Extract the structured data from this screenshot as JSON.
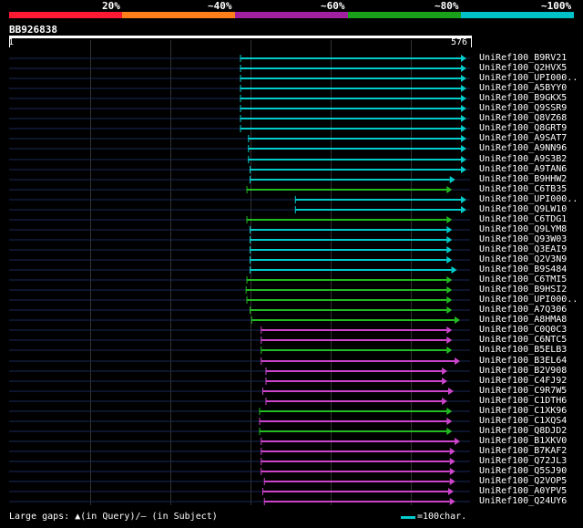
{
  "legend": {
    "labels": [
      "20%",
      "~40%",
      "~60%",
      "~80%",
      "~100%"
    ],
    "colors": [
      "#ff1a33",
      "#ff7f1a",
      "#a020a0",
      "#1aa01a",
      "#00c0c8"
    ]
  },
  "query": {
    "name": "BB926838",
    "start_label": "1",
    "end_label": "576",
    "length": 576
  },
  "hits": [
    {
      "label": "UniRef100_B9RV21",
      "start": 292,
      "end": 576,
      "color": "#00cccc"
    },
    {
      "label": "UniRef100_Q2HVX5",
      "start": 292,
      "end": 576,
      "color": "#00cccc"
    },
    {
      "label": "UniRef100_UPI000..",
      "start": 292,
      "end": 576,
      "color": "#00cccc"
    },
    {
      "label": "UniRef100_A5BYY0",
      "start": 292,
      "end": 576,
      "color": "#00cccc"
    },
    {
      "label": "UniRef100_B9GKX5",
      "start": 292,
      "end": 576,
      "color": "#00cccc"
    },
    {
      "label": "UniRef100_Q9SSR9",
      "start": 292,
      "end": 576,
      "color": "#00cccc"
    },
    {
      "label": "UniRef100_Q8VZ68",
      "start": 292,
      "end": 576,
      "color": "#00cccc"
    },
    {
      "label": "UniRef100_Q8GRT9",
      "start": 292,
      "end": 576,
      "color": "#00cccc"
    },
    {
      "label": "UniRef100_A9SAT7",
      "start": 302,
      "end": 576,
      "color": "#00cccc"
    },
    {
      "label": "UniRef100_A9NN96",
      "start": 302,
      "end": 576,
      "color": "#00cccc"
    },
    {
      "label": "UniRef100_A9S3B2",
      "start": 302,
      "end": 576,
      "color": "#00cccc"
    },
    {
      "label": "UniRef100_A9TAN6",
      "start": 304,
      "end": 576,
      "color": "#00cccc"
    },
    {
      "label": "UniRef100_B9HHW2",
      "start": 304,
      "end": 562,
      "color": "#00cccc"
    },
    {
      "label": "UniRef100_C6TB35",
      "start": 300,
      "end": 558,
      "color": "#22bb22"
    },
    {
      "label": "UniRef100_UPI000..",
      "start": 361,
      "end": 576,
      "color": "#00cccc"
    },
    {
      "label": "UniRef100_Q9LW10",
      "start": 361,
      "end": 576,
      "color": "#00cccc"
    },
    {
      "label": "UniRef100_C6TDG1",
      "start": 300,
      "end": 558,
      "color": "#22bb22"
    },
    {
      "label": "UniRef100_Q9LYM8",
      "start": 304,
      "end": 558,
      "color": "#00cccc"
    },
    {
      "label": "UniRef100_Q93W03",
      "start": 304,
      "end": 558,
      "color": "#00cccc"
    },
    {
      "label": "UniRef100_Q3EAI9",
      "start": 304,
      "end": 558,
      "color": "#00cccc"
    },
    {
      "label": "UniRef100_Q2V3N9",
      "start": 304,
      "end": 558,
      "color": "#00cccc"
    },
    {
      "label": "UniRef100_B9S484",
      "start": 304,
      "end": 564,
      "color": "#00cccc"
    },
    {
      "label": "UniRef100_C6TMI5",
      "start": 300,
      "end": 558,
      "color": "#22bb22"
    },
    {
      "label": "UniRef100_B9HSI2",
      "start": 299,
      "end": 558,
      "color": "#22bb22"
    },
    {
      "label": "UniRef100_UPI000..",
      "start": 300,
      "end": 558,
      "color": "#22bb22"
    },
    {
      "label": "UniRef100_A7Q306",
      "start": 304,
      "end": 558,
      "color": "#22bb22"
    },
    {
      "label": "UniRef100_A8HMA8",
      "start": 306,
      "end": 568,
      "color": "#22bb22"
    },
    {
      "label": "UniRef100_C0Q0C3",
      "start": 318,
      "end": 558,
      "color": "#cc44cc"
    },
    {
      "label": "UniRef100_C6NTC5",
      "start": 318,
      "end": 558,
      "color": "#cc44cc"
    },
    {
      "label": "UniRef100_B5ELB3",
      "start": 318,
      "end": 558,
      "color": "#22bb22"
    },
    {
      "label": "UniRef100_B3EL64",
      "start": 318,
      "end": 568,
      "color": "#cc44cc"
    },
    {
      "label": "UniRef100_B2V908",
      "start": 324,
      "end": 552,
      "color": "#cc44cc"
    },
    {
      "label": "UniRef100_C4FJ92",
      "start": 324,
      "end": 552,
      "color": "#cc44cc"
    },
    {
      "label": "UniRef100_C9R7W5",
      "start": 320,
      "end": 560,
      "color": "#cc44cc"
    },
    {
      "label": "UniRef100_C1DTH6",
      "start": 324,
      "end": 552,
      "color": "#cc44cc"
    },
    {
      "label": "UniRef100_C1XK96",
      "start": 316,
      "end": 558,
      "color": "#22bb22"
    },
    {
      "label": "UniRef100_C1XQS4",
      "start": 316,
      "end": 558,
      "color": "#cc44cc"
    },
    {
      "label": "UniRef100_Q8DJD2",
      "start": 316,
      "end": 558,
      "color": "#22bb22"
    },
    {
      "label": "UniRef100_B1XKV0",
      "start": 318,
      "end": 568,
      "color": "#cc44cc"
    },
    {
      "label": "UniRef100_B7KAF2",
      "start": 318,
      "end": 562,
      "color": "#cc44cc"
    },
    {
      "label": "UniRef100_Q72JL3",
      "start": 318,
      "end": 562,
      "color": "#cc44cc"
    },
    {
      "label": "UniRef100_Q5SJ90",
      "start": 318,
      "end": 562,
      "color": "#cc44cc"
    },
    {
      "label": "UniRef100_Q2VOP5",
      "start": 322,
      "end": 562,
      "color": "#cc44cc"
    },
    {
      "label": "UniRef100_A0YPV5",
      "start": 320,
      "end": 560,
      "color": "#cc44cc"
    },
    {
      "label": "UniRef100_Q24UY6",
      "start": 322,
      "end": 562,
      "color": "#cc44cc"
    }
  ],
  "footer": {
    "gaps_text": "Large gaps: ▲(in Query)/– (in Subject)",
    "scale_text": "=100char.",
    "scale_color": "#00cccc"
  }
}
